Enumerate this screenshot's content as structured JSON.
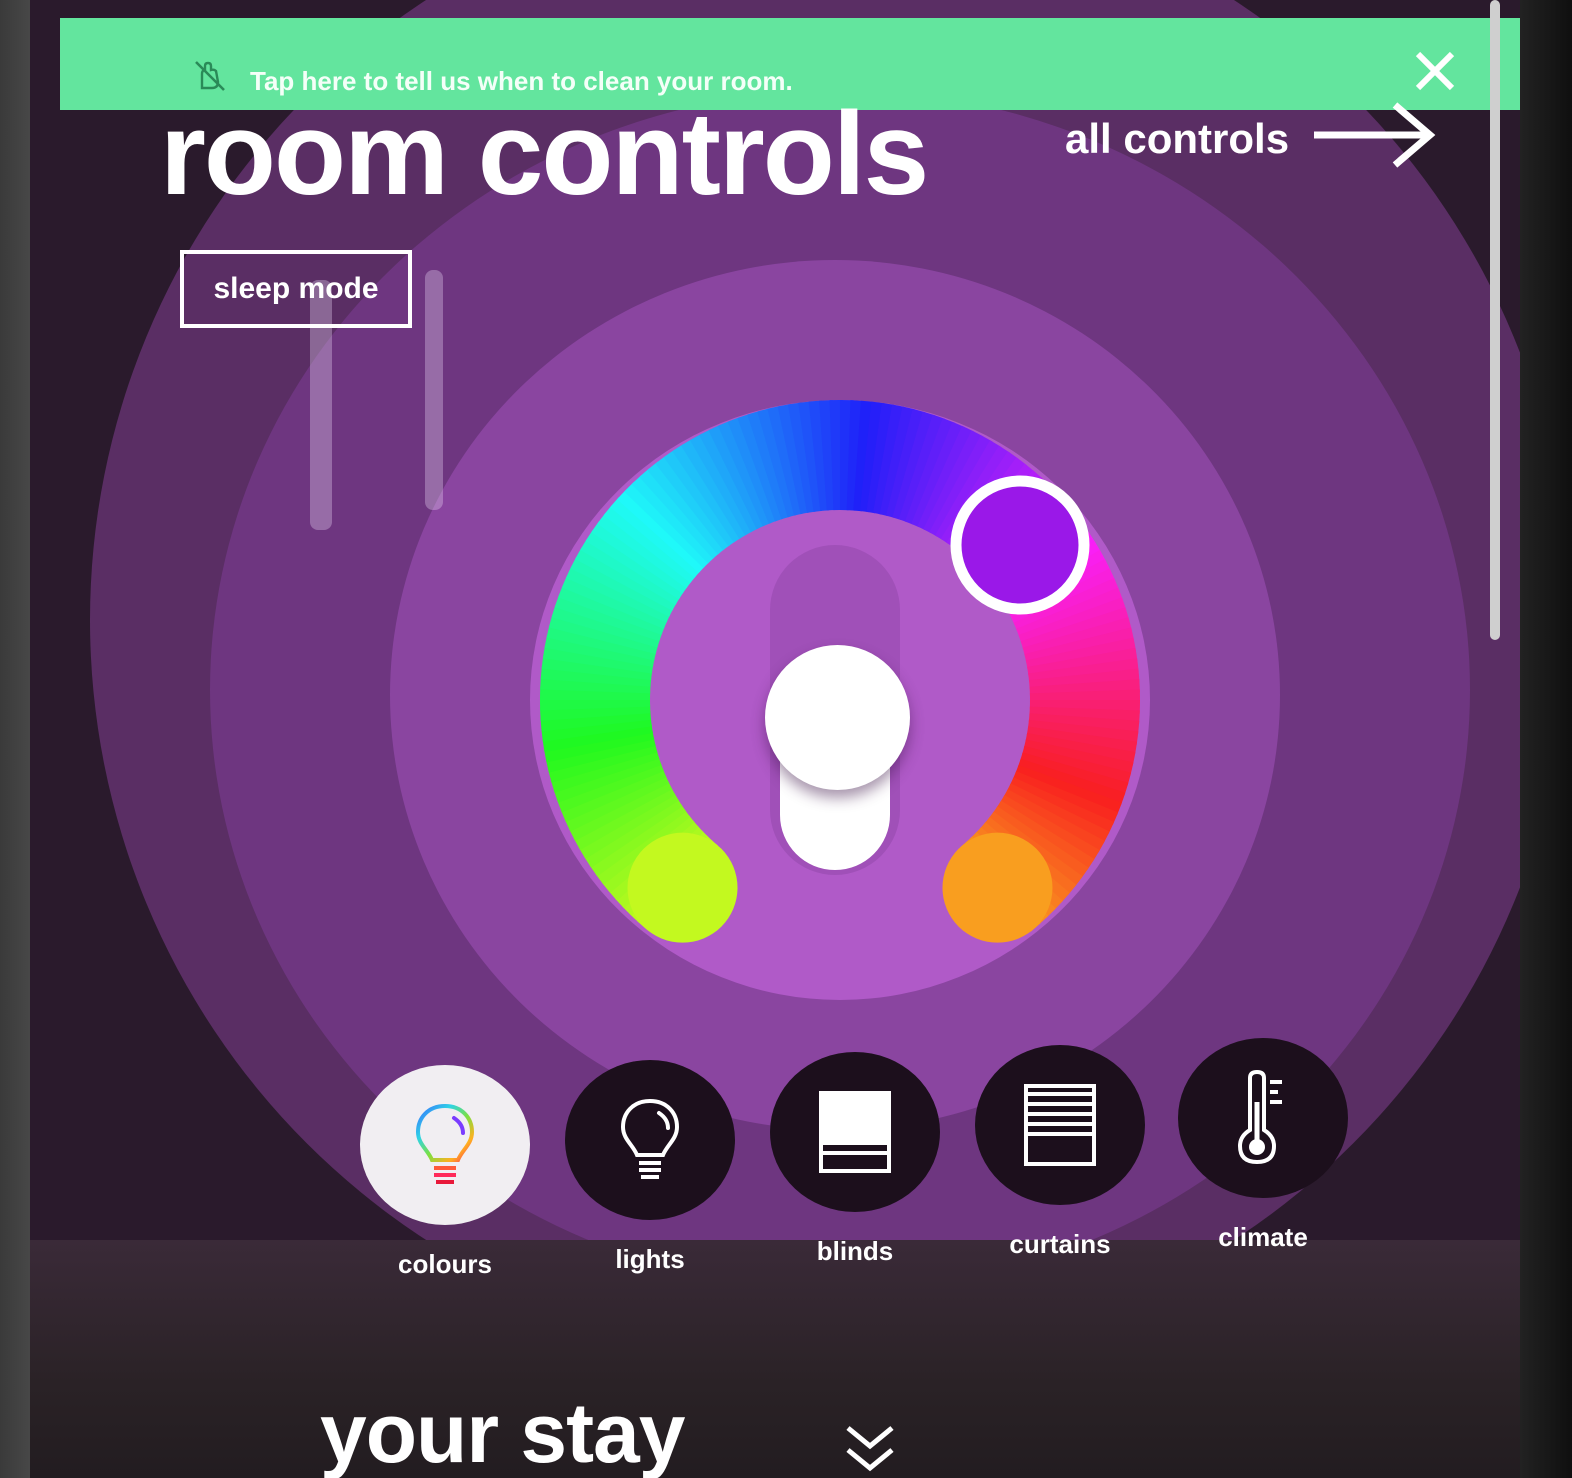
{
  "banner": {
    "text": "Tap here to tell us when to clean your room.",
    "icon": "no-touch-hand-icon",
    "close_icon": "close-icon",
    "color": "#63e59e"
  },
  "header": {
    "title": "room controls",
    "all_controls_label": "all controls",
    "arrow_icon": "arrow-right-icon"
  },
  "sleep_mode": {
    "label": "sleep mode"
  },
  "colour_wheel": {
    "selected_color": "#9a18e8",
    "brightness_level": 0.45
  },
  "dock": {
    "items": [
      {
        "label": "colours",
        "icon": "rainbow-bulb-icon",
        "active": true
      },
      {
        "label": "lights",
        "icon": "bulb-icon",
        "active": false
      },
      {
        "label": "blinds",
        "icon": "blinds-icon",
        "active": false
      },
      {
        "label": "curtains",
        "icon": "curtains-icon",
        "active": false
      },
      {
        "label": "climate",
        "icon": "thermometer-icon",
        "active": false
      }
    ]
  },
  "your_stay": {
    "title": "your stay",
    "expand_icon": "chevron-double-down-icon"
  },
  "colors": {
    "background_purple": "#6e3680",
    "accent_green": "#63e59e"
  }
}
